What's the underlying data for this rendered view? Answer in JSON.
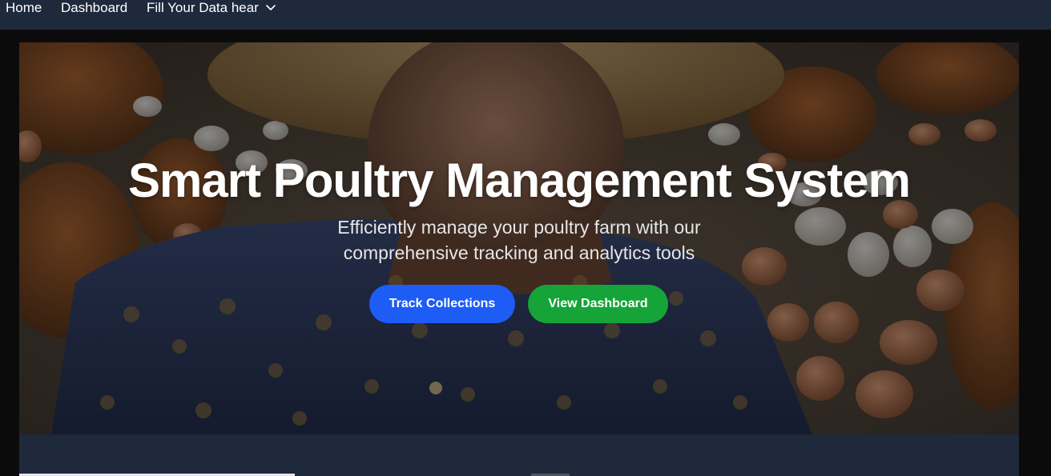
{
  "nav": {
    "home": "Home",
    "dashboard": "Dashboard",
    "fill_data": "Fill Your Data hear",
    "fill_data_icon": "chevron-down-icon"
  },
  "hero": {
    "title": "Smart Poultry Management System",
    "subtitle": "Efficiently manage your poultry farm with our comprehensive tracking and analytics tools",
    "buttons": {
      "track": "Track Collections",
      "view": "View Dashboard"
    }
  },
  "colors": {
    "nav_bg": "#1e293b",
    "page_bg": "#0b0b0c",
    "track_button": "#1d5cf5",
    "view_button": "#16a338"
  }
}
